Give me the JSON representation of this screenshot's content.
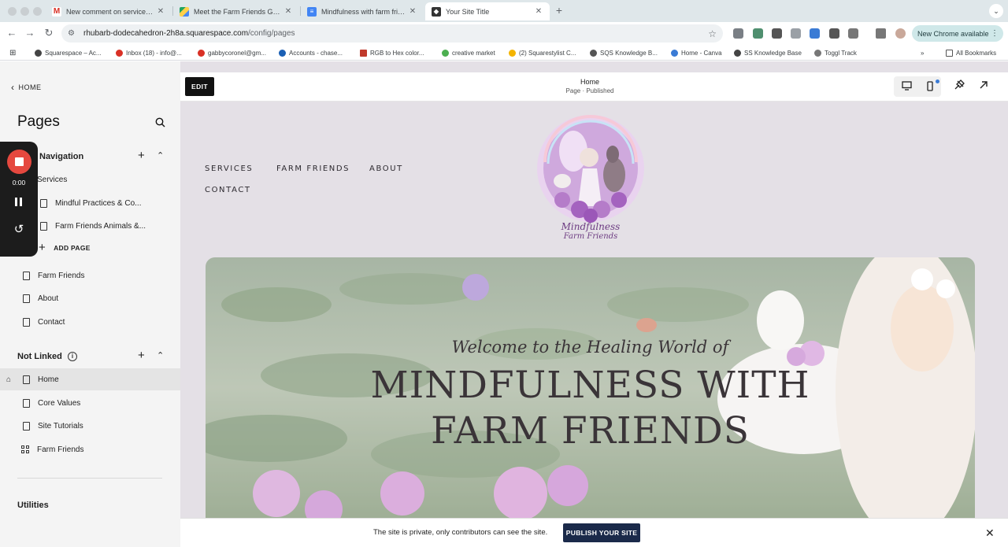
{
  "browser": {
    "tabs": [
      {
        "title": "New comment on services pa",
        "favicon": "gmail-icon",
        "active": false
      },
      {
        "title": "Meet the Farm Friends Galler",
        "favicon": "google-drive-icon",
        "active": false
      },
      {
        "title": "Mindfulness with farm friend",
        "favicon": "google-docs-icon",
        "active": false
      },
      {
        "title": "Your Site Title",
        "favicon": "squarespace-icon",
        "active": true
      }
    ],
    "url_host": "rhubarb-dodecahedron-2h8a.squarespace.com",
    "url_path": "/config/pages",
    "chrome_update_label": "New Chrome available",
    "bookmarks": [
      "Squarespace – Ac...",
      "Inbox (18) - info@...",
      "gabbycoronel@gm...",
      "Accounts - chase...",
      "RGB to Hex color...",
      "creative market",
      "(2) Squarestylist C...",
      "SQS Knowledge B...",
      "Home - Canva",
      "SS Knowledge Base",
      "Toggl Track"
    ],
    "all_bookmarks_label": "All Bookmarks"
  },
  "sidebar": {
    "back_label": "HOME",
    "title": "Pages",
    "main_nav": {
      "title": "Navigation",
      "items": [
        {
          "label": "Services",
          "icon": "folder-icon"
        },
        {
          "label": "Mindful Practices & Co...",
          "icon": "page-icon"
        },
        {
          "label": "Farm Friends Animals &...",
          "icon": "page-icon"
        }
      ],
      "add_page_label": "ADD PAGE",
      "more_items": [
        {
          "label": "Farm Friends",
          "icon": "page-icon"
        },
        {
          "label": "About",
          "icon": "page-icon"
        },
        {
          "label": "Contact",
          "icon": "page-icon"
        }
      ]
    },
    "not_linked": {
      "title": "Not Linked",
      "items": [
        {
          "label": "Home",
          "icon": "page-icon",
          "selected": true,
          "homepage": true
        },
        {
          "label": "Core Values",
          "icon": "page-icon"
        },
        {
          "label": "Site Tutorials",
          "icon": "page-icon"
        },
        {
          "label": "Farm Friends",
          "icon": "grid-icon"
        }
      ]
    },
    "utilities_title": "Utilities"
  },
  "recorder": {
    "time": "0:00",
    "stop_color": "#e5483f"
  },
  "editor": {
    "edit_label": "EDIT",
    "page_title": "Home",
    "page_status": "Page · Published"
  },
  "site": {
    "nav": [
      "SERVICES",
      "FARM FRIENDS",
      "ABOUT",
      "CONTACT"
    ],
    "hero_subtitle": "Welcome to the Healing World of",
    "hero_title_line1": "Mindfulness with",
    "hero_title_line2": "Farm Friends",
    "logo_text_1": "Mindfulness",
    "logo_text_2": "Farm Friends"
  },
  "privacy": {
    "message": "The site is private, only contributors can see the site.",
    "publish_label": "PUBLISH YOUR SITE",
    "publish_color": "#1b2a4a"
  }
}
